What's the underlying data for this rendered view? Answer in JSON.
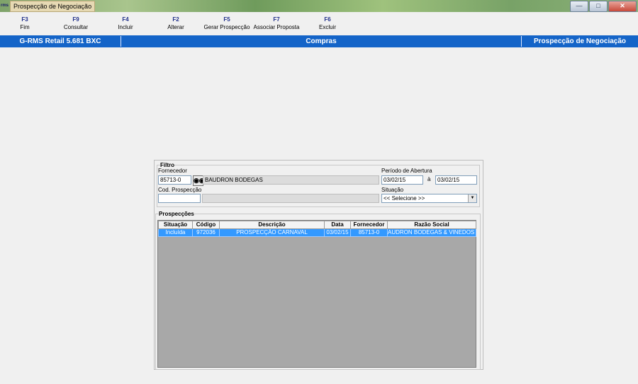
{
  "window": {
    "title": "Prospecção de Negociação",
    "app_icon_text": "rms",
    "buttons": [
      "minimize-icon",
      "maximize-icon",
      "close-icon"
    ]
  },
  "toolbar": {
    "items": [
      {
        "key": "F3",
        "label": "Fim"
      },
      {
        "key": "F9",
        "label": "Consultar"
      },
      {
        "key": "F4",
        "label": "Incluir"
      },
      {
        "key": "F2",
        "label": "Alterar"
      },
      {
        "key": "F5",
        "label": "Gerar Prospecção"
      },
      {
        "key": "F7",
        "label": "Associar Proposta"
      },
      {
        "key": "F6",
        "label": "Excluir"
      }
    ]
  },
  "statusbar": {
    "version": "G-RMS Retail 5.681 BXC",
    "module": "Compras",
    "screen": "Prospecção de Negociação",
    "color": "#1464c8"
  },
  "filtro": {
    "legend": "Filtro",
    "fornecedor_label": "Fornecedor",
    "fornecedor_code": "85713-0",
    "fornecedor_name": "BAUDRON BODEGAS",
    "search_icon": "binoculars-icon",
    "periodo_label": "Período de Abertura",
    "periodo_from": "03/02/15",
    "periodo_sep": "à",
    "periodo_to": "03/02/15",
    "cod_label": "Cod. Prospecção",
    "cod_value": "",
    "cod_desc": "",
    "situacao_label": "Situação",
    "situacao_value": "<< Selecione >>"
  },
  "prospeccoes": {
    "legend": "Prospecções",
    "columns": [
      "Situação",
      "Código",
      "Descrição",
      "Data",
      "Fornecedor",
      "Razão Social"
    ],
    "rows": [
      [
        "Incluída",
        "972036",
        "PROSPECÇÃO CARNAVAL",
        "03/02/15",
        "85713-0",
        "AUDRON BODEGAS & VINEDOS S."
      ]
    ],
    "selected_color": "#3399ff"
  }
}
